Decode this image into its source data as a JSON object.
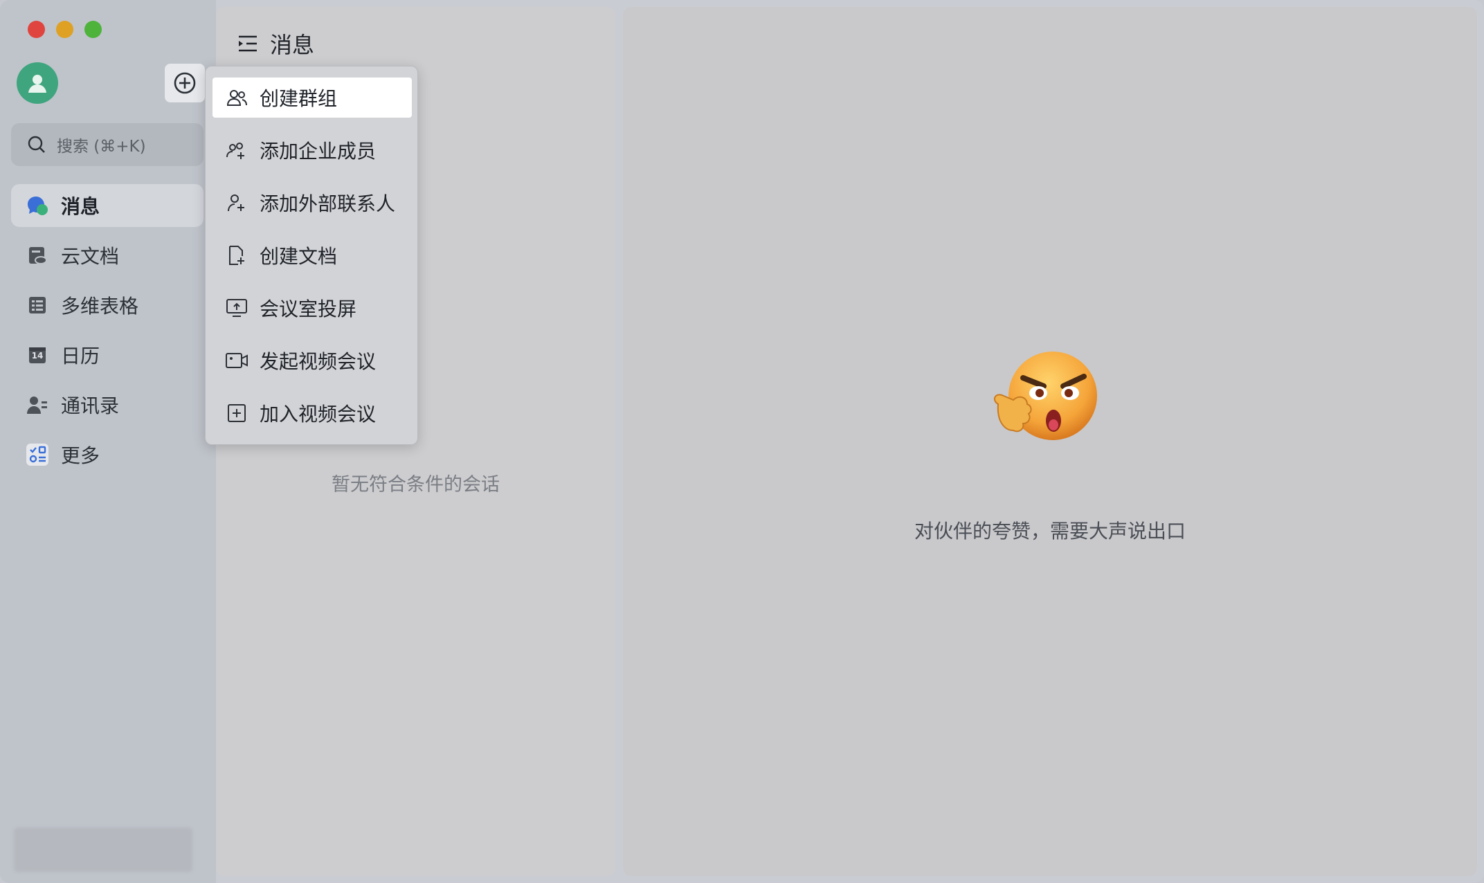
{
  "sidebar": {
    "search_placeholder": "搜索 (⌘+K)",
    "items": [
      {
        "label": "消息",
        "icon": "message-icon",
        "active": true
      },
      {
        "label": "云文档",
        "icon": "cloud-doc-icon"
      },
      {
        "label": "多维表格",
        "icon": "table-icon"
      },
      {
        "label": "日历",
        "icon": "calendar-icon",
        "badge_text": "14"
      },
      {
        "label": "通讯录",
        "icon": "contacts-icon"
      },
      {
        "label": "更多",
        "icon": "more-apps-icon"
      }
    ]
  },
  "middle": {
    "title": "消息",
    "empty_text": "暂无符合条件的会话"
  },
  "right": {
    "tagline": "对伙伴的夸赞，需要大声说出口"
  },
  "menu": {
    "items": [
      {
        "label": "创建群组",
        "icon": "group-icon",
        "highlighted": true
      },
      {
        "label": "添加企业成员",
        "icon": "add-members-icon"
      },
      {
        "label": "添加外部联系人",
        "icon": "add-contact-icon"
      },
      {
        "label": "创建文档",
        "icon": "new-doc-icon"
      },
      {
        "label": "会议室投屏",
        "icon": "screen-share-icon"
      },
      {
        "label": "发起视频会议",
        "icon": "video-call-icon"
      },
      {
        "label": "加入视频会议",
        "icon": "join-meeting-icon"
      }
    ]
  },
  "colors": {
    "accent_blue": "#3370ff",
    "avatar_green": "#3fa57e"
  }
}
